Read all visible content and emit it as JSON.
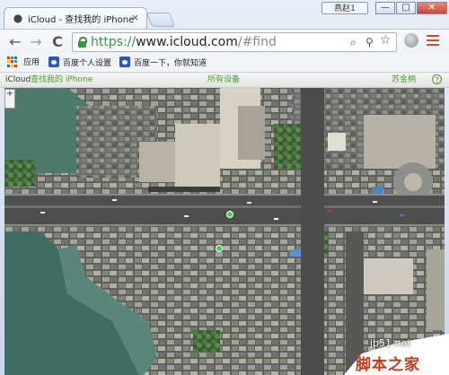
{
  "window": {
    "user_badge": "燕赵1"
  },
  "tab": {
    "title": "iCloud - 查找我的 iPhone",
    "close": "×"
  },
  "window_controls": {
    "minimize": "—",
    "maximize": "□",
    "close": "✕"
  },
  "toolbar": {
    "back": "←",
    "forward": "→",
    "reload": "C"
  },
  "omnibox": {
    "scheme": "https://",
    "host": "www.icloud.com",
    "path": "/#find"
  },
  "omnibox_icons": {
    "search": "⌕",
    "key": "⚲",
    "star": "☆"
  },
  "bookmarks": {
    "apps_label": "应用",
    "items": [
      "百度个人设置",
      "百度一下，你就知道"
    ]
  },
  "icloud_bar": {
    "brand": "iCloud",
    "app": "查找我的 iPhone",
    "devices": "所有设备",
    "user": "苏金柄",
    "help": "?"
  },
  "map": {
    "zoom_label": "+"
  },
  "watermark": {
    "site": "jb51.net",
    "name": "脚本之家"
  },
  "colors": {
    "accent_green": "#4a9d2e",
    "pin": "#48d24a",
    "lock_green": "#2f9b3c",
    "watermark": "#c6391c"
  }
}
